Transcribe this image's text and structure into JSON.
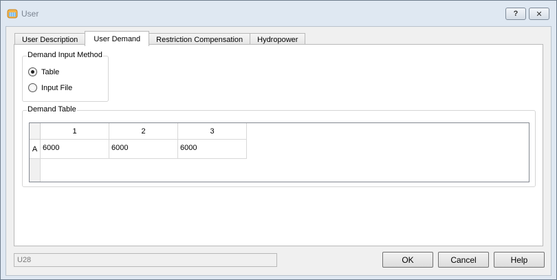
{
  "window": {
    "title": "User",
    "help_glyph": "?",
    "close_glyph": "✕"
  },
  "tabs": [
    {
      "label": "User Description",
      "active": false
    },
    {
      "label": "User Demand",
      "active": true
    },
    {
      "label": "Restriction Compensation",
      "active": false
    },
    {
      "label": "Hydropower",
      "active": false
    }
  ],
  "demand_input_method": {
    "label": "Demand Input Method",
    "options": [
      {
        "label": "Table",
        "selected": true
      },
      {
        "label": "Input File",
        "selected": false
      }
    ]
  },
  "demand_table": {
    "label": "Demand Table",
    "columns": [
      "1",
      "2",
      "3"
    ],
    "rows": [
      {
        "header": "A",
        "cells": [
          "6000",
          "6000",
          "6000"
        ]
      }
    ]
  },
  "footer": {
    "status_value": "U28",
    "ok_label": "OK",
    "cancel_label": "Cancel",
    "help_label": "Help"
  }
}
